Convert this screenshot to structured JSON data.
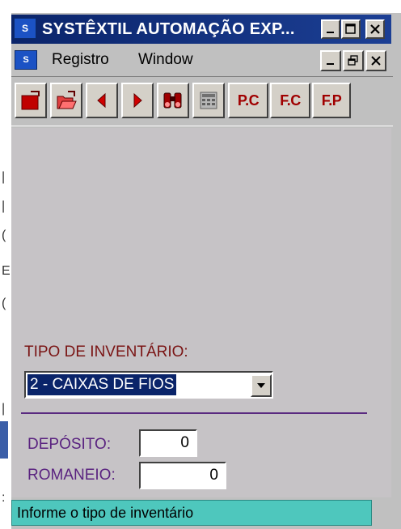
{
  "window": {
    "title": "SYSTÊXTIL AUTOMAÇÃO EXP...",
    "app_icon": "systextil-icon"
  },
  "menu": {
    "items": [
      {
        "label": "Registro"
      },
      {
        "label": "Window"
      }
    ]
  },
  "toolbar": {
    "buttons": [
      {
        "name": "new-record-button",
        "icon": "folder-red-icon"
      },
      {
        "name": "open-record-button",
        "icon": "folder-open-icon"
      },
      {
        "name": "previous-button",
        "icon": "arrow-left-icon"
      },
      {
        "name": "next-button",
        "icon": "arrow-right-icon"
      },
      {
        "name": "search-button",
        "icon": "binoculars-icon"
      },
      {
        "name": "calculator-button",
        "icon": "calculator-icon"
      },
      {
        "name": "pc-button",
        "label": "P.C"
      },
      {
        "name": "fc-button",
        "label": "F.C"
      },
      {
        "name": "fp-button",
        "label": "F.P"
      }
    ]
  },
  "form": {
    "tipo_label": "TIPO DE INVENTÁRIO:",
    "tipo_value": "2 - CAIXAS DE FIOS",
    "deposito_label": "DEPÓSITO:",
    "deposito_value": "0",
    "romaneio_label": "ROMANEIO:",
    "romaneio_value": "0"
  },
  "status": {
    "message": "Informe o tipo de inventário"
  },
  "colors": {
    "titlebar": "#0a246a",
    "form_bg": "#c6c3c6",
    "tipo_label": "#7a1414",
    "purple_label": "#5a2380",
    "status_bg": "#4ec7bd",
    "toolbar_text": "#a00000"
  }
}
